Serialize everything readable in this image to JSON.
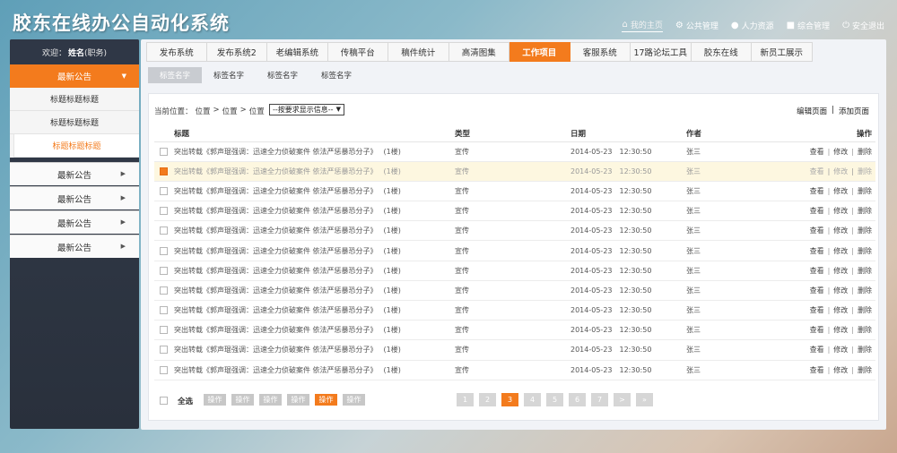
{
  "app": {
    "title": "胶东在线办公自动化系统"
  },
  "top_nav": [
    {
      "label": "我的主页",
      "icon": "home-icon",
      "active": true
    },
    {
      "label": "公共管理",
      "icon": "gear-icon"
    },
    {
      "label": "人力资源",
      "icon": "user-icon"
    },
    {
      "label": "综合管理",
      "icon": "chat-icon"
    },
    {
      "label": "安全退出",
      "icon": "power-icon"
    }
  ],
  "sidebar": {
    "welcome_prefix": "欢迎：",
    "user_name": "姓名",
    "user_role": "(职务)",
    "active_group": "最新公告",
    "sub_items": [
      "标题标题标题",
      "标题标题标题",
      "标题标题标题"
    ],
    "groups": [
      "最新公告",
      "最新公告",
      "最新公告",
      "最新公告"
    ]
  },
  "tabs": [
    "发布系统",
    "发布系统2",
    "老编辑系统",
    "传稿平台",
    "稿件统计",
    "高清图集",
    "工作项目",
    "客服系统",
    "17路论坛工具",
    "胶东在线",
    "新员工展示"
  ],
  "active_tab": "工作项目",
  "subtabs": [
    "标签名字",
    "标签名字",
    "标签名字",
    "标签名字"
  ],
  "breadcrumb": {
    "prefix": "当前位置：",
    "parts": [
      "位置",
      "位置",
      "位置"
    ],
    "sep": ">"
  },
  "filter_select": {
    "value": "--按要求显示信息--"
  },
  "actions": {
    "edit": "编辑页面",
    "sep": "|",
    "add": "添加页面"
  },
  "table": {
    "columns": [
      "标题",
      "类型",
      "日期",
      "作者",
      "操作"
    ],
    "rows": [
      {
        "title": "突出转载《郭声琨强调：迅速全力侦破案件 依法严惩暴恐分子》",
        "count": "(1楼)",
        "type": "宣传",
        "date": "2014-05-23",
        "time": "12:30:50",
        "author": "张三"
      },
      {
        "title": "突出转载《郭声琨强调：迅速全力侦破案件 依法严惩暴恐分子》",
        "count": "(1楼)",
        "type": "宣传",
        "date": "2014-05-23",
        "time": "12:30:50",
        "author": "张三",
        "highlight": true
      },
      {
        "title": "突出转载《郭声琨强调：迅速全力侦破案件 依法严惩暴恐分子》",
        "count": "(1楼)",
        "type": "宣传",
        "date": "2014-05-23",
        "time": "12:30:50",
        "author": "张三"
      },
      {
        "title": "突出转载《郭声琨强调：迅速全力侦破案件 依法严惩暴恐分子》",
        "count": "(1楼)",
        "type": "宣传",
        "date": "2014-05-23",
        "time": "12:30:50",
        "author": "张三"
      },
      {
        "title": "突出转载《郭声琨强调：迅速全力侦破案件 依法严惩暴恐分子》",
        "count": "(1楼)",
        "type": "宣传",
        "date": "2014-05-23",
        "time": "12:30:50",
        "author": "张三"
      },
      {
        "title": "突出转载《郭声琨强调：迅速全力侦破案件 依法严惩暴恐分子》",
        "count": "(1楼)",
        "type": "宣传",
        "date": "2014-05-23",
        "time": "12:30:50",
        "author": "张三"
      },
      {
        "title": "突出转载《郭声琨强调：迅速全力侦破案件 依法严惩暴恐分子》",
        "count": "(1楼)",
        "type": "宣传",
        "date": "2014-05-23",
        "time": "12:30:50",
        "author": "张三"
      },
      {
        "title": "突出转载《郭声琨强调：迅速全力侦破案件 依法严惩暴恐分子》",
        "count": "(1楼)",
        "type": "宣传",
        "date": "2014-05-23",
        "time": "12:30:50",
        "author": "张三"
      },
      {
        "title": "突出转载《郭声琨强调：迅速全力侦破案件 依法严惩暴恐分子》",
        "count": "(1楼)",
        "type": "宣传",
        "date": "2014-05-23",
        "time": "12:30:50",
        "author": "张三"
      },
      {
        "title": "突出转载《郭声琨强调：迅速全力侦破案件 依法严惩暴恐分子》",
        "count": "(1楼)",
        "type": "宣传",
        "date": "2014-05-23",
        "time": "12:30:50",
        "author": "张三"
      },
      {
        "title": "突出转载《郭声琨强调：迅速全力侦破案件 依法严惩暴恐分子》",
        "count": "(1楼)",
        "type": "宣传",
        "date": "2014-05-23",
        "time": "12:30:50",
        "author": "张三"
      },
      {
        "title": "突出转载《郭声琨强调：迅速全力侦破案件 依法严惩暴恐分子》",
        "count": "(1楼)",
        "type": "宣传",
        "date": "2014-05-23",
        "time": "12:30:50",
        "author": "张三"
      }
    ],
    "row_ops": [
      "查看",
      "修改",
      "删除"
    ],
    "checked_row": 1
  },
  "footer": {
    "select_all": "全选",
    "op_buttons": [
      "操作",
      "操作",
      "操作",
      "操作",
      "操作",
      "操作"
    ],
    "active_op": 4,
    "pages": [
      "1",
      "2",
      "3",
      "4",
      "5",
      "6",
      "7",
      ">",
      "»"
    ],
    "active_page": "3"
  },
  "colors": {
    "accent": "#f37b1d",
    "sidebar_bg": "#2c3440",
    "highlight_row": "#fdf7e0"
  }
}
